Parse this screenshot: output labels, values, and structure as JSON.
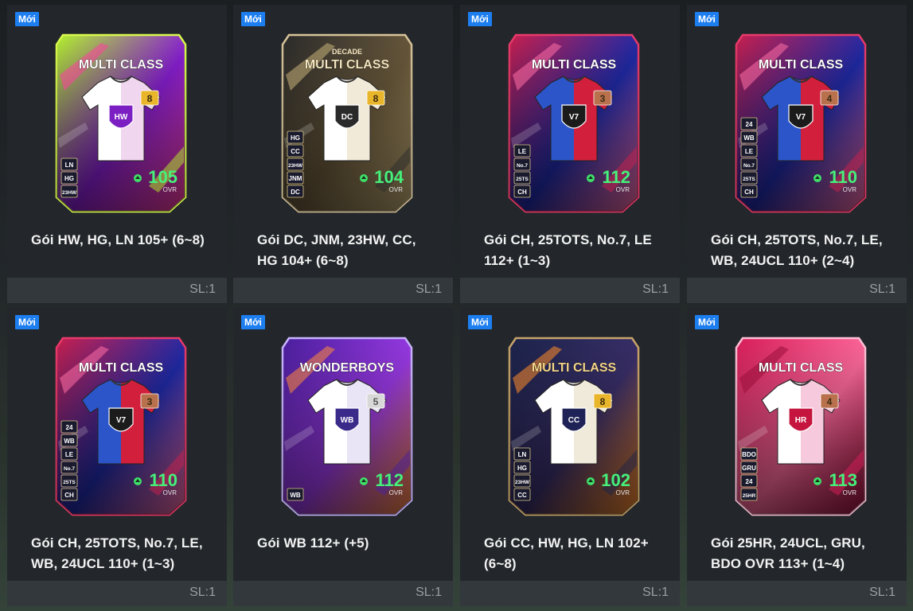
{
  "badge_label": "Mới",
  "ovr_label": "OVR",
  "packs": [
    {
      "title": "Gói HW, HG, LN 105+ (6~8)",
      "qty": "SL:1",
      "card": {
        "season": "MULTI CLASS",
        "subtitle": "",
        "grade": "8",
        "ovr": "105",
        "tags": [
          "LN",
          "HG",
          "23HW"
        ],
        "theme": "neon",
        "crest": "HW"
      }
    },
    {
      "title": "Gói DC, JNM, 23HW, CC, HG 104+ (6~8)",
      "qty": "SL:1",
      "card": {
        "season": "MULTI CLASS",
        "subtitle": "DECADE",
        "grade": "8",
        "ovr": "104",
        "tags": [
          "HG",
          "CC",
          "23HW",
          "JNM",
          "DC"
        ],
        "theme": "gold",
        "crest": "DC"
      }
    },
    {
      "title": "Gói CH, 25TOTS, No.7, LE 112+ (1~3)",
      "qty": "SL:1",
      "card": {
        "season": "MULTI CLASS",
        "subtitle": "",
        "grade": "3",
        "ovr": "112",
        "tags": [
          "LE",
          "No.7",
          "25TS",
          "CH"
        ],
        "theme": "red",
        "crest": "V7"
      }
    },
    {
      "title": "Gói CH, 25TOTS, No.7, LE, WB, 24UCL 110+ (2~4)",
      "qty": "SL:1",
      "card": {
        "season": "MULTI CLASS",
        "subtitle": "",
        "grade": "4",
        "ovr": "110",
        "tags": [
          "24",
          "WB",
          "LE",
          "No.7",
          "25TS",
          "CH"
        ],
        "theme": "red",
        "crest": "V7"
      }
    },
    {
      "title": "Gói CH, 25TOTS, No.7, LE, WB, 24UCL 110+ (1~3)",
      "qty": "SL:1",
      "card": {
        "season": "MULTI CLASS",
        "subtitle": "",
        "grade": "3",
        "ovr": "110",
        "tags": [
          "24",
          "WB",
          "LE",
          "No.7",
          "25TS",
          "CH"
        ],
        "theme": "red",
        "crest": "V7"
      }
    },
    {
      "title": "Gói WB 112+ (+5)",
      "qty": "SL:1",
      "card": {
        "season": "WONDERBOYS",
        "subtitle": "",
        "grade": "5",
        "ovr": "112",
        "tags": [
          "WB"
        ],
        "theme": "purple",
        "crest": "WB"
      }
    },
    {
      "title": "Gói CC, HW, HG, LN 102+ (6~8)",
      "qty": "SL:1",
      "card": {
        "season": "MULTI CLASS",
        "subtitle": "",
        "grade": "8",
        "ovr": "102",
        "tags": [
          "LN",
          "HG",
          "23HW",
          "CC"
        ],
        "theme": "navy",
        "crest": "CC"
      }
    },
    {
      "title": "Gói 25HR, 24UCL, GRU, BDO OVR 113+ (1~4)",
      "qty": "SL:1",
      "card": {
        "season": "MULTI CLASS",
        "subtitle": "",
        "grade": "4",
        "ovr": "113",
        "tags": [
          "BDO",
          "GRU",
          "24",
          "25HR"
        ],
        "theme": "pink",
        "crest": "HR"
      }
    }
  ]
}
